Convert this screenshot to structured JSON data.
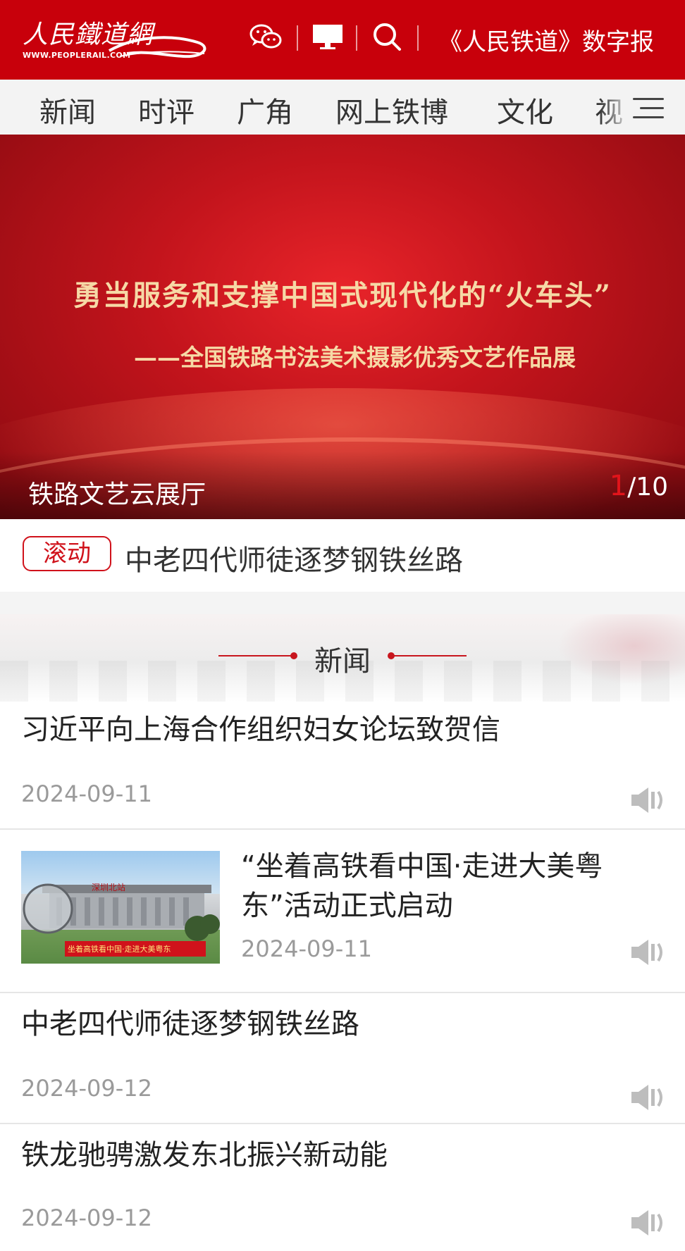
{
  "header": {
    "logo_cn": "人民鐵道網",
    "logo_en": "WWW.PEOPLERAIL.COM",
    "digital_label": "《人民铁道》数字报",
    "icons": [
      "wechat-icon",
      "desktop-icon",
      "search-icon"
    ],
    "brand_color": "#c8000b"
  },
  "nav": {
    "items": [
      "新闻",
      "时评",
      "广角",
      "网上铁博",
      "文化",
      "视"
    ]
  },
  "banner": {
    "title": "勇当服务和支撑中国式现代化的“火车头”",
    "subtitle": "——全国铁路书法美术摄影优秀文艺作品展",
    "caption": "铁路文艺云展厅",
    "current": "1",
    "total": "/10"
  },
  "rolling": {
    "badge": "滚动",
    "text": "中老四代师徒逐梦钢铁丝路"
  },
  "section": {
    "title": "新闻"
  },
  "news": [
    {
      "title": "习近平向上海合作组织妇女论坛致贺信",
      "date": "2024-09-11"
    },
    {
      "title_line1": "“坐着高铁看中国·走进大美粤",
      "title_line2": "东”活动正式启动",
      "date": "2024-09-11",
      "thumb_sign": "深圳北站",
      "thumb_banner": "坐着高铁看中国·走进大美粤东"
    },
    {
      "title": "中老四代师徒逐梦钢铁丝路",
      "date": "2024-09-12"
    },
    {
      "title": "铁龙驰骋激发东北振兴新动能",
      "date": "2024-09-12"
    }
  ]
}
